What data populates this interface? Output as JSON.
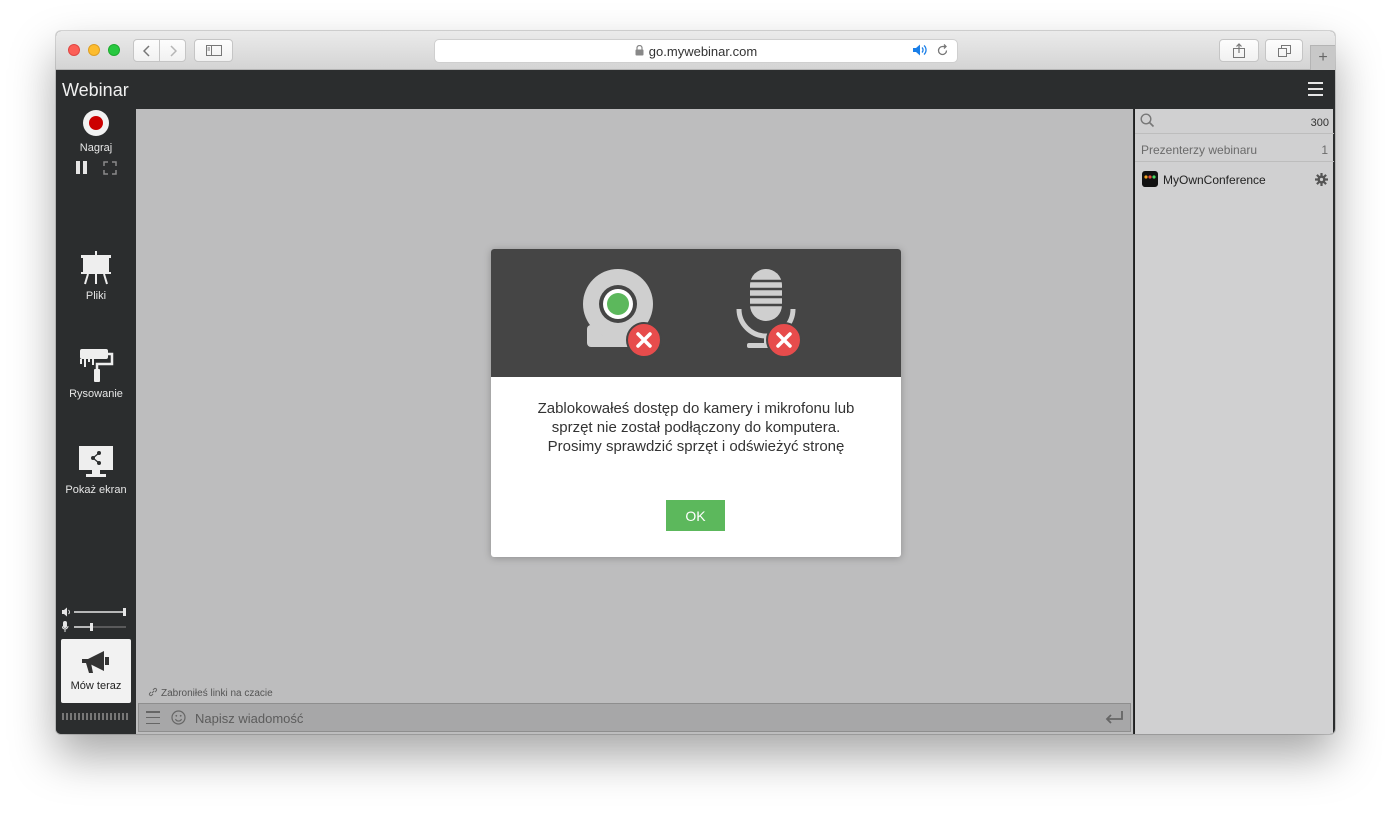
{
  "browser": {
    "url": "go.mywebinar.com",
    "plus_label": "+"
  },
  "app": {
    "title": "Webinar"
  },
  "toolbar": {
    "record_label": "Nagraj",
    "files_label": "Pliki",
    "drawing_label": "Rysowanie",
    "share_screen_label": "Pokaż ekran",
    "speak_now_label": "Mów teraz"
  },
  "chat": {
    "links_notice": "Zabroniłeś linki na czacie",
    "placeholder": "Napisz wiadomość"
  },
  "participants": {
    "total_count": "300",
    "section_title": "Prezenterzy webinaru",
    "section_count": "1",
    "users": [
      {
        "name": "MyOwnConference"
      }
    ]
  },
  "modal": {
    "message_lines": [
      "Zablokowałeś dostęp do kamery i mikrofonu lub",
      "sprzęt nie został podłączony do komputera.",
      "Prosimy sprawdzić sprzęt i odświeżyć stronę"
    ],
    "ok_label": "OK"
  },
  "colors": {
    "accent_ok": "#5cb85c",
    "record_red": "#cc0000",
    "error_red": "#e74c4c",
    "camera_green": "#5cb85c"
  }
}
